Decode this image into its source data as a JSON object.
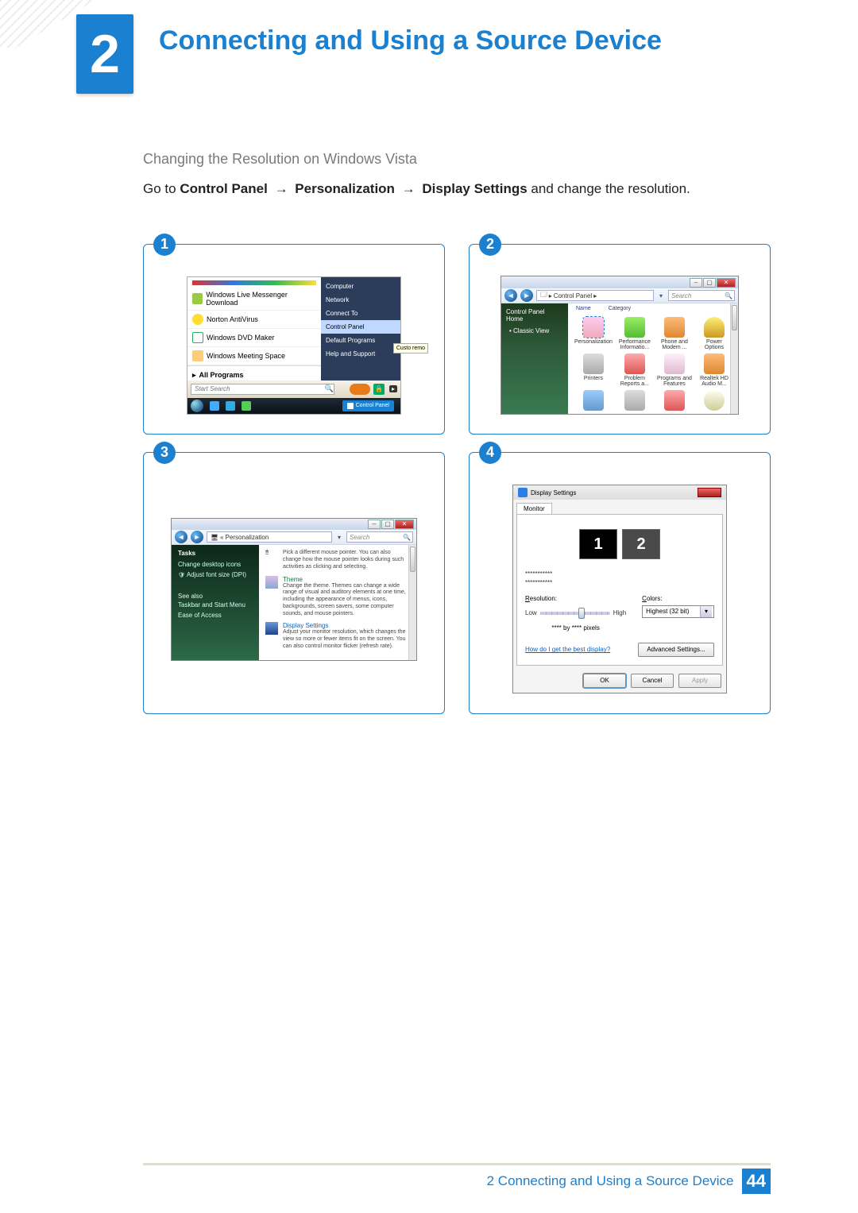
{
  "chapter": {
    "number": "2",
    "title": "Connecting and Using a Source Device"
  },
  "section": {
    "subheading": "Changing the Resolution on Windows Vista",
    "intro_pre": "Go to ",
    "path1": "Control Panel",
    "arrow": "→",
    "path2": "Personalization",
    "path3": "Display Settings",
    "intro_post": " and change the resolution."
  },
  "steps": {
    "s1": "1",
    "s2": "2",
    "s3": "3",
    "s4": "4"
  },
  "startmenu": {
    "left_items": [
      {
        "label": "Windows Live Messenger Download"
      },
      {
        "label": "Norton AntiVirus"
      },
      {
        "label": "Windows DVD Maker"
      },
      {
        "label": "Windows Meeting Space"
      }
    ],
    "all_programs": "All Programs",
    "right_items": [
      "Computer",
      "Network",
      "Connect To",
      "Control Panel",
      "Default Programs",
      "Help and Support"
    ],
    "highlighted": "Control Panel",
    "tooltip": "Custo\nremo",
    "search_placeholder": "Start Search",
    "taskbar_tab": "Control Panel"
  },
  "cpwin": {
    "breadcrumb": "Control Panel",
    "search_placeholder": "Search",
    "side_header": "Control Panel Home",
    "side_item": "Classic View",
    "toolbar": {
      "name": "Name",
      "category": "Category"
    },
    "icons": [
      "Personalization",
      "Performance Informatio...",
      "Phone and Modem ...",
      "Power Options",
      "Printers",
      "Problem Reports a...",
      "Programs and Features",
      "Realtek HD Audio M..."
    ]
  },
  "pzn": {
    "breadcrumb": "Personalization",
    "search_placeholder": "Search",
    "tasks_header": "Tasks",
    "tasks": [
      "Change desktop icons",
      "Adjust font size (DPI)"
    ],
    "seealso_header": "See also",
    "seealso": [
      "Taskbar and Start Menu",
      "Ease of Access"
    ],
    "entries": [
      {
        "title": "",
        "desc": "Pick a different mouse pointer. You can also change how the mouse pointer looks during such activities as clicking and selecting."
      },
      {
        "title": "Theme",
        "title_class": "g",
        "desc": "Change the theme. Themes can change a wide range of visual and auditory elements at one time, including the appearance of menus, icons, backgrounds, screen savers, some computer sounds, and mouse pointers."
      },
      {
        "title": "Display Settings",
        "title_class": "",
        "desc": "Adjust your monitor resolution, which changes the view so more or fewer items fit on the screen. You can also control monitor flicker (refresh rate)."
      }
    ]
  },
  "dlg": {
    "title": "Display Settings",
    "tab": "Monitor",
    "mask1": "***********",
    "mask2": "***********",
    "res_label": "Resolution:",
    "res_low": "Low",
    "res_high": "High",
    "pixels_line": "**** by **** pixels",
    "colors_label": "Colors:",
    "colors_value": "Highest (32 bit)",
    "help_link": "How do I get the best display?",
    "advanced": "Advanced Settings...",
    "ok": "OK",
    "cancel": "Cancel",
    "apply": "Apply",
    "monitor_1": "1",
    "monitor_2": "2"
  },
  "footer": {
    "chapter_line": "2 Connecting and Using a Source Device",
    "page": "44"
  }
}
